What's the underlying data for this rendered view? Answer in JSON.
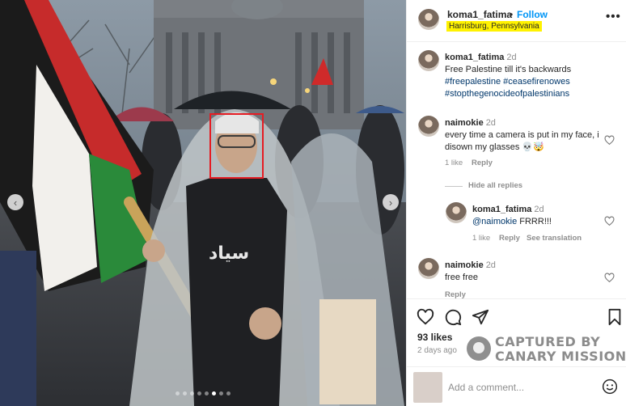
{
  "post": {
    "username": "koma1_fatima",
    "separator": "•",
    "follow_label": "Follow",
    "location": "Harrisburg, Pennsylvania",
    "more_icon": "more-icon"
  },
  "carousel": {
    "total": 8,
    "active_index": 5
  },
  "comments": [
    {
      "username": "koma1_fatima",
      "time": "2d",
      "text": "Free Palestine till it's backwards",
      "tags": [
        "#freepalestine #ceasefirenowes",
        "#stopthegenocideofpalestinians"
      ]
    },
    {
      "username": "naimokie",
      "time": "2d",
      "text": "every time a camera is put in my face, i disown my glasses 💀🤯",
      "likes": "1 like",
      "reply": "Reply",
      "hide_replies": "Hide all replies",
      "replies": [
        {
          "username": "koma1_fatima",
          "time": "2d",
          "mention": "@naimokie",
          "text": "FRRR!!!",
          "likes": "1 like",
          "reply": "Reply",
          "translate": "See translation"
        }
      ]
    },
    {
      "username": "naimokie",
      "time": "2d",
      "text": "free free",
      "reply": "Reply"
    }
  ],
  "footer": {
    "likes": "93 likes",
    "date": "2 days ago",
    "add_comment_placeholder": "Add a comment..."
  },
  "watermark": {
    "line1": "CAPTURED BY",
    "line2": "CANARY MISSION"
  },
  "colors": {
    "link_blue": "#0095f6",
    "location_highlight": "#fff200",
    "face_box": "#e51c23"
  }
}
